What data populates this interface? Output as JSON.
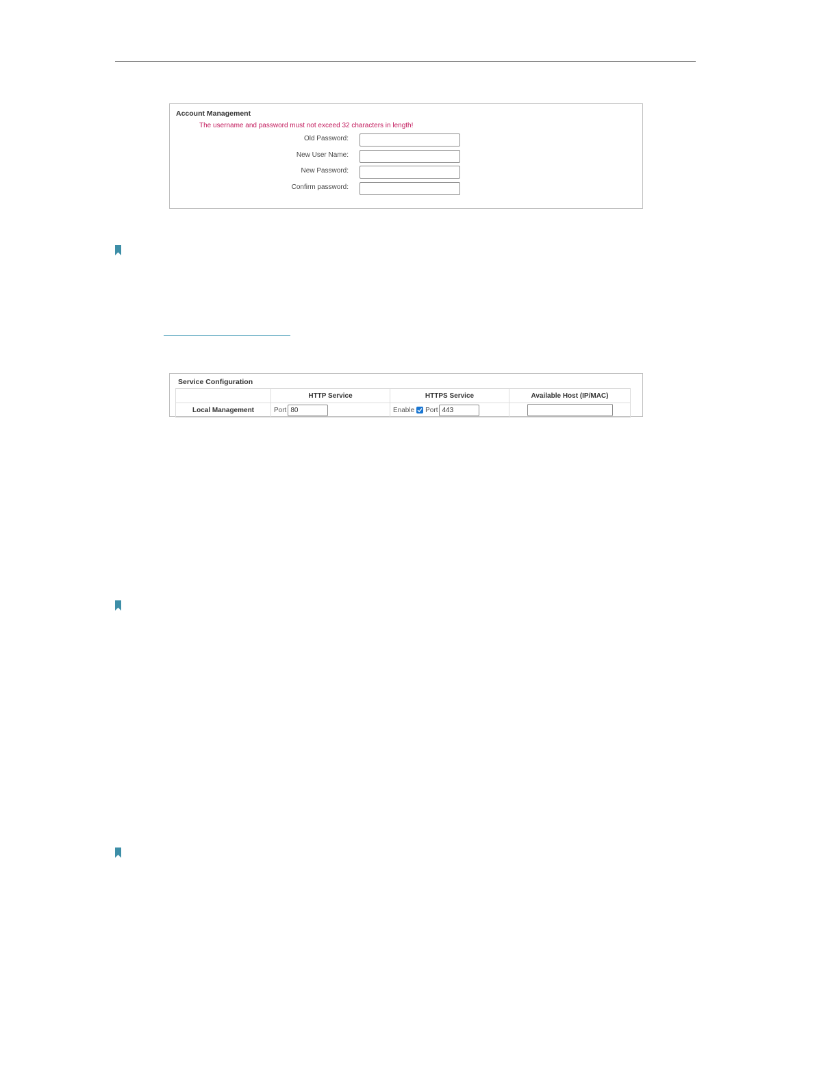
{
  "colors": {
    "warning_text": "#c2185b",
    "accent": "#2f8fae",
    "bookmark": "#3d8ea7",
    "checkbox": "#1976d2"
  },
  "account_management": {
    "title": "Account Management",
    "warning": "The username and password must not exceed 32 characters in length!",
    "fields": [
      {
        "label": "Old Password:",
        "value": ""
      },
      {
        "label": "New User Name:",
        "value": ""
      },
      {
        "label": "New Password:",
        "value": ""
      },
      {
        "label": "Confirm password:",
        "value": ""
      }
    ]
  },
  "bookmark_icons": [
    "bookmark-icon",
    "bookmark-icon",
    "bookmark-icon"
  ],
  "service_configuration": {
    "title": "Service Configuration",
    "columns": [
      "",
      "HTTP Service",
      "HTTPS Service",
      "Available Host (IP/MAC)"
    ],
    "rows": [
      {
        "name": "Local Management",
        "http_port_label": "Port",
        "http_port": "80",
        "https_enable_label": "Enable",
        "https_enabled": true,
        "https_port_label": "Port",
        "https_port": "443",
        "available_host": ""
      }
    ]
  }
}
